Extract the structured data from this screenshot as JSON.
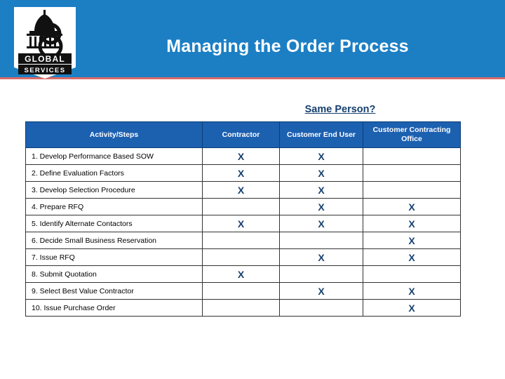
{
  "header": {
    "title": "Managing the Order Process",
    "band_color": "#1c7fc4",
    "underline_color": "#d96a6a"
  },
  "logo": {
    "name": "global-services-logo",
    "top_text": "GLOBAL",
    "bottom_text": "SERVICES"
  },
  "annotation": {
    "same_person_label": "Same Person?"
  },
  "table": {
    "columns": [
      "Activity/Steps",
      "Contractor",
      "Customer End User",
      "Customer Contracting Office"
    ],
    "mark": "X",
    "rows": [
      {
        "label": "1. Develop Performance Based SOW",
        "contractor": "X",
        "end_user": "X",
        "office": ""
      },
      {
        "label": "2. Define Evaluation Factors",
        "contractor": "X",
        "end_user": "X",
        "office": ""
      },
      {
        "label": "3. Develop Selection Procedure",
        "contractor": "X",
        "end_user": "X",
        "office": ""
      },
      {
        "label": "4. Prepare RFQ",
        "contractor": "",
        "end_user": "X",
        "office": "X"
      },
      {
        "label": "5. Identify Alternate Contactors",
        "contractor": "X",
        "end_user": "X",
        "office": "X"
      },
      {
        "label": "6. Decide Small Business Reservation",
        "contractor": "",
        "end_user": "",
        "office": "X"
      },
      {
        "label": "7. Issue RFQ",
        "contractor": "",
        "end_user": "X",
        "office": "X"
      },
      {
        "label": "8. Submit Quotation",
        "contractor": "X",
        "end_user": "",
        "office": ""
      },
      {
        "label": "9. Select Best Value Contractor",
        "contractor": "",
        "end_user": "X",
        "office": "X"
      },
      {
        "label": "10. Issue Purchase Order",
        "contractor": "",
        "end_user": "",
        "office": "X"
      }
    ]
  }
}
